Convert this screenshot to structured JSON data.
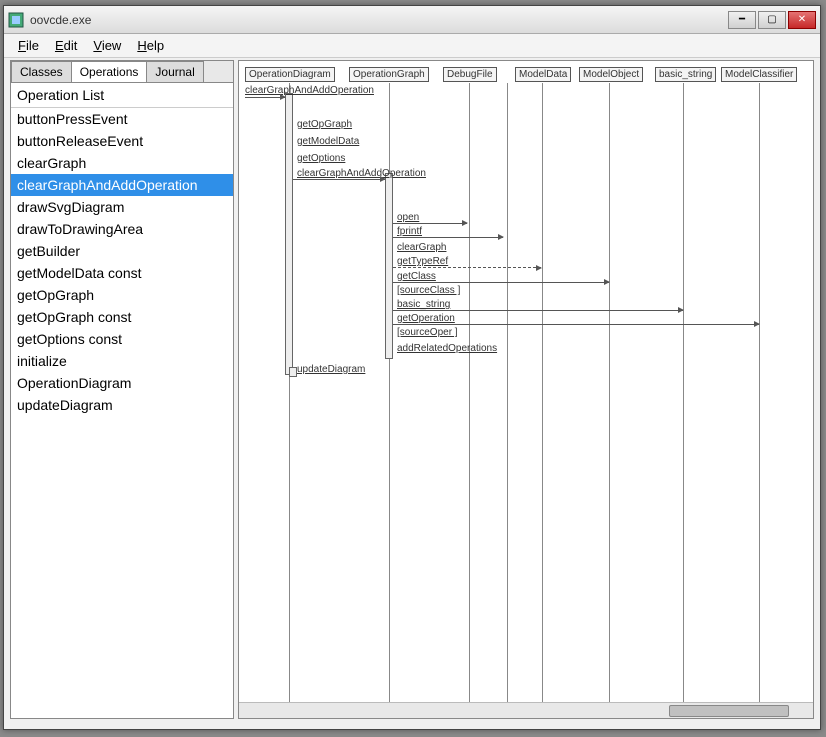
{
  "window": {
    "title": "oovcde.exe"
  },
  "menu": {
    "file": "File",
    "edit": "Edit",
    "view": "View",
    "help": "Help"
  },
  "tabs": {
    "t0": "Classes",
    "t1": "Operations",
    "t2": "Journal"
  },
  "list_header": "Operation List",
  "ops": {
    "i0": "buttonPressEvent",
    "i1": "buttonReleaseEvent",
    "i2": "clearGraph",
    "i3": "clearGraphAndAddOperation",
    "i4": "drawSvgDiagram",
    "i5": "drawToDrawingArea",
    "i6": "getBuilder",
    "i7": "getModelData const",
    "i8": "getOpGraph",
    "i9": "getOpGraph const",
    "i10": "getOptions const",
    "i11": "initialize",
    "i12": "OperationDiagram",
    "i13": "updateDiagram"
  },
  "objects": {
    "o0": "OperationDiagram",
    "o1": "OperationGraph",
    "o2": "DebugFile",
    "o3": "ModelData",
    "o4": "ModelObject",
    "o5": "basic_string",
    "o6": "ModelClassifier"
  },
  "messages": {
    "m0": "clearGraphAndAddOperation",
    "m1": "getOpGraph",
    "m2": "getModelData",
    "m3": "getOptions",
    "m4": "clearGraphAndAddOperation",
    "m5": "open",
    "m6": "fprintf",
    "m7": "clearGraph",
    "m8": "getTypeRef",
    "m9": "getClass",
    "m10": "[sourceClass ]",
    "m11": "basic_string",
    "m12": "getOperation",
    "m13": "[sourceOper ]",
    "m14": "addRelatedOperations",
    "m15": "updateDiagram"
  }
}
